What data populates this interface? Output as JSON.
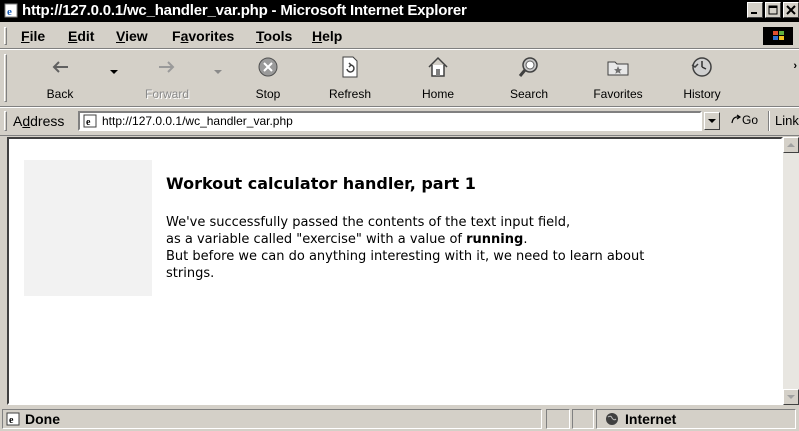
{
  "window": {
    "title": "http://127.0.0.1/wc_handler_var.php - Microsoft Internet Explorer"
  },
  "menu": {
    "items": [
      {
        "accel": "F",
        "rest": "ile"
      },
      {
        "accel": "E",
        "rest": "dit"
      },
      {
        "accel": "V",
        "rest": "iew"
      },
      {
        "pre": "F",
        "accel": "a",
        "rest": "vorites"
      },
      {
        "accel": "T",
        "rest": "ools"
      },
      {
        "accel": "H",
        "rest": "elp"
      }
    ]
  },
  "toolbar": {
    "back": "Back",
    "forward": "Forward",
    "stop": "Stop",
    "refresh": "Refresh",
    "home": "Home",
    "search": "Search",
    "favorites": "Favorites",
    "history": "History"
  },
  "address": {
    "label_pre": "A",
    "label_accel": "d",
    "label_post": "dress",
    "url": "http://127.0.0.1/wc_handler_var.php",
    "go": "Go",
    "links": "Links"
  },
  "page": {
    "heading": "Workout calculator handler, part 1",
    "line1": "We've successfully passed the contents of the text input field,",
    "line2_pre": "as a variable called \"exercise\" with a value of ",
    "line2_value": "running",
    "line2_post": ".",
    "line3": "But before we can do anything interesting with it, we need to learn about",
    "line4": "strings."
  },
  "status": {
    "text": "Done",
    "zone": "Internet"
  },
  "colors": {
    "titlebar": "#000000",
    "chrome": "#d4d0c8",
    "content_bg": "#ffffff",
    "sidebox": "#f2f2f2"
  }
}
